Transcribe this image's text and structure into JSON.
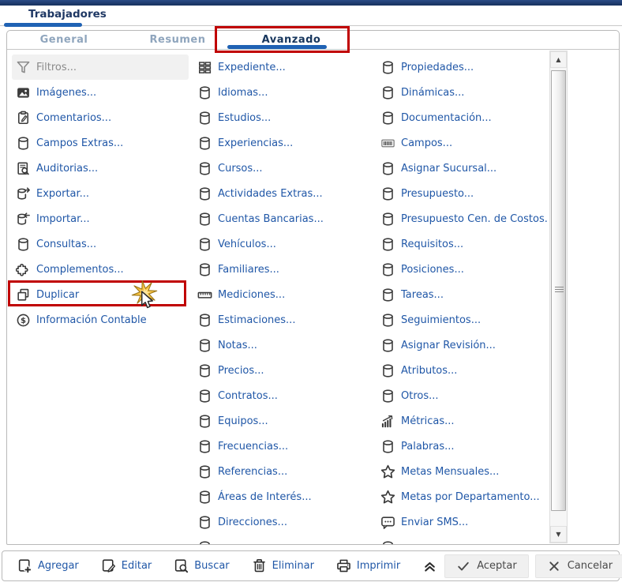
{
  "colors": {
    "accent_navy": "#1c3c6e",
    "accent_blue": "#1f62b4",
    "link_blue": "#2057a7",
    "inactive_tab": "#8fa5bd",
    "annotation_red": "#c00000",
    "icon_dark": "#3b3b3b",
    "muted_gray": "#8a8a8a",
    "button_bg": "#f0f0f0"
  },
  "window": {
    "title": "Trabajadores"
  },
  "tabs": [
    {
      "label": "General",
      "name": "tab-general",
      "active": false
    },
    {
      "label": "Resumen",
      "name": "tab-resumen",
      "active": false
    },
    {
      "label": "Avanzado",
      "name": "tab-avanzado",
      "active": true
    }
  ],
  "annotations": {
    "highlighted_tab": "Avanzado",
    "highlighted_menu_item": "Duplicar"
  },
  "menu": {
    "column1": [
      {
        "label": "Filtros...",
        "icon": "filter-icon",
        "state": "hover-gray"
      },
      {
        "label": "Imágenes...",
        "icon": "image-icon"
      },
      {
        "label": "Comentarios...",
        "icon": "clipboard-pencil-icon"
      },
      {
        "label": "Campos Extras...",
        "icon": "database-icon"
      },
      {
        "label": "Auditorias...",
        "icon": "audit-icon"
      },
      {
        "label": "Exportar...",
        "icon": "export-icon"
      },
      {
        "label": "Importar...",
        "icon": "import-icon"
      },
      {
        "label": "Consultas...",
        "icon": "database-icon"
      },
      {
        "label": "Complementos...",
        "icon": "puzzle-icon"
      },
      {
        "label": "Duplicar",
        "icon": "copy-icon",
        "state": "highlighted"
      },
      {
        "label": "Información Contable",
        "icon": "dollar-circle-icon"
      }
    ],
    "column2": [
      {
        "label": "Expediente...",
        "icon": "grid-icon"
      },
      {
        "label": "Idiomas...",
        "icon": "database-icon"
      },
      {
        "label": "Estudios...",
        "icon": "database-icon"
      },
      {
        "label": "Experiencias...",
        "icon": "database-icon"
      },
      {
        "label": "Cursos...",
        "icon": "database-icon"
      },
      {
        "label": "Actividades Extras...",
        "icon": "database-icon"
      },
      {
        "label": "Cuentas Bancarias...",
        "icon": "database-icon"
      },
      {
        "label": "Vehículos...",
        "icon": "database-icon"
      },
      {
        "label": "Familiares...",
        "icon": "database-icon"
      },
      {
        "label": "Mediciones...",
        "icon": "ruler-icon"
      },
      {
        "label": "Estimaciones...",
        "icon": "database-icon"
      },
      {
        "label": "Notas...",
        "icon": "database-icon"
      },
      {
        "label": "Precios...",
        "icon": "database-icon"
      },
      {
        "label": "Contratos...",
        "icon": "database-icon"
      },
      {
        "label": "Equipos...",
        "icon": "database-icon"
      },
      {
        "label": "Frecuencias...",
        "icon": "database-icon"
      },
      {
        "label": "Referencias...",
        "icon": "database-icon"
      },
      {
        "label": "Áreas de Interés...",
        "icon": "database-icon"
      },
      {
        "label": "Direcciones...",
        "icon": "database-icon"
      },
      {
        "label": "",
        "icon": "database-icon",
        "partial": true
      }
    ],
    "column3": [
      {
        "label": "Propiedades...",
        "icon": "database-icon"
      },
      {
        "label": "Dinámicas...",
        "icon": "database-icon"
      },
      {
        "label": "Documentación...",
        "icon": "database-icon"
      },
      {
        "label": "Campos...",
        "icon": "barcode-icon"
      },
      {
        "label": "Asignar Sucursal...",
        "icon": "database-icon"
      },
      {
        "label": "Presupuesto...",
        "icon": "database-icon"
      },
      {
        "label": "Presupuesto Cen. de Costos.",
        "icon": "database-icon"
      },
      {
        "label": "Requisitos...",
        "icon": "database-icon"
      },
      {
        "label": "Posiciones...",
        "icon": "database-icon"
      },
      {
        "label": "Tareas...",
        "icon": "database-icon"
      },
      {
        "label": "Seguimientos...",
        "icon": "database-icon"
      },
      {
        "label": "Asignar Revisión...",
        "icon": "database-icon"
      },
      {
        "label": "Atributos...",
        "icon": "database-icon"
      },
      {
        "label": "Otros...",
        "icon": "database-icon"
      },
      {
        "label": "Métricas...",
        "icon": "metrics-icon"
      },
      {
        "label": "Palabras...",
        "icon": "database-icon"
      },
      {
        "label": "Metas Mensuales...",
        "icon": "star-icon"
      },
      {
        "label": "Metas por Departamento...",
        "icon": "star-icon"
      },
      {
        "label": "Enviar SMS...",
        "icon": "sms-icon"
      },
      {
        "label": "",
        "icon": "database-icon",
        "partial": true
      }
    ]
  },
  "toolbar": {
    "actions": [
      {
        "label": "Agregar",
        "icon": "add-document-icon",
        "name": "agregar-button"
      },
      {
        "label": "Editar",
        "icon": "edit-document-icon",
        "name": "editar-button"
      },
      {
        "label": "Buscar",
        "icon": "search-document-icon",
        "name": "buscar-button"
      },
      {
        "label": "Eliminar",
        "icon": "trash-icon",
        "name": "eliminar-button"
      },
      {
        "label": "Imprimir",
        "icon": "printer-icon",
        "name": "imprimir-button"
      },
      {
        "label": "",
        "icon": "collapse-chevrons-icon",
        "name": "collapse-toolbar-button",
        "state": "no-label"
      }
    ],
    "buttons": [
      {
        "label": "Aceptar",
        "icon": "check-icon",
        "name": "aceptar-button"
      },
      {
        "label": "Cancelar",
        "icon": "x-icon",
        "name": "cancelar-button"
      }
    ]
  }
}
